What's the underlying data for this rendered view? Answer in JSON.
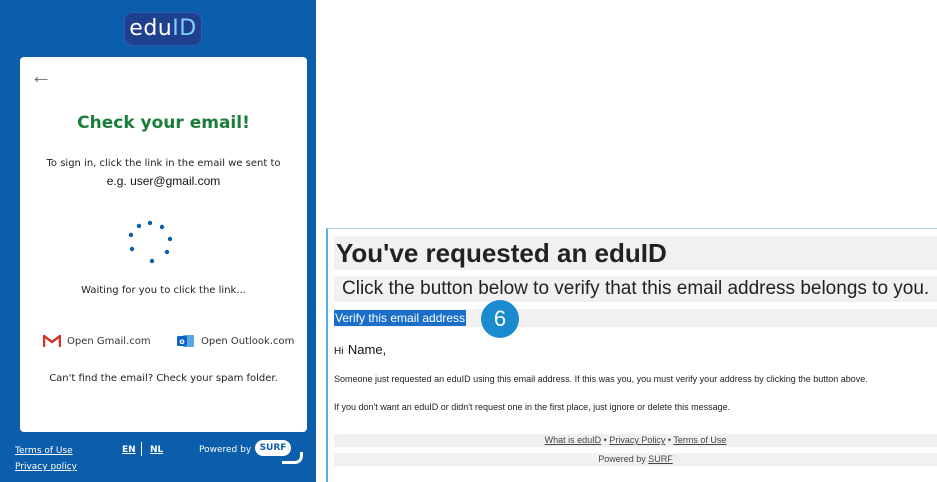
{
  "app": {
    "logo_text_a": "edu",
    "logo_text_b": "ID",
    "back_icon": "arrow-left-icon",
    "card": {
      "title": "Check your email!",
      "instruction": "To sign in, click the link in the email we sent to",
      "email": "e.g. user@gmail.com",
      "waiting": "Waiting for you to click the link...",
      "gmail_label": "Open Gmail.com",
      "outlook_label": "Open Outlook.com",
      "spam_note": "Can't find the email? Check your spam folder."
    },
    "footer": {
      "terms": "Terms of Use",
      "privacy": "Privacy policy",
      "lang_en": "EN",
      "lang_nl": "NL",
      "powered_by": "Powered by",
      "surf": "SURF"
    },
    "colors": {
      "primary": "#0b5eac",
      "title_green": "#1a7d3a",
      "logo_bg": "#1f3f8f"
    }
  },
  "email": {
    "heading": "You've requested an eduID",
    "subheading": "Click the button below to verify that this email address belongs to you.",
    "verify_link": "Verify this email address",
    "step_badge": "6",
    "greeting_hi": "Hi",
    "greeting_name": "Name,",
    "para1": "Someone just requested an eduID using this email address. If this was you, you must verify your address by clicking the button above.",
    "para2": "If you don't want an eduID or didn't request one in the first place, just ignore or delete this message.",
    "footer_links": {
      "what": "What is eduID",
      "sep": "•",
      "privacy": "Privacy Policy",
      "terms": "Terms of Use"
    },
    "powered_by": "Powered by",
    "surf": "SURF",
    "colors": {
      "highlight": "#1a6fc9",
      "badge": "#1a8bcf",
      "border": "#55aee3"
    }
  }
}
